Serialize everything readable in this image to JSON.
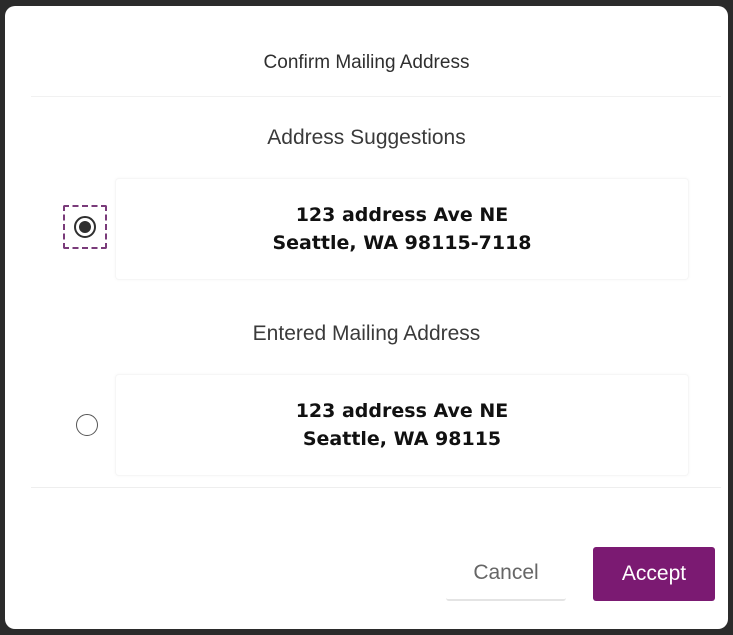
{
  "dialog": {
    "title": "Confirm Mailing Address"
  },
  "suggestions": {
    "heading": "Address Suggestions",
    "address": {
      "line1": "123 address Ave NE",
      "line2": "Seattle, WA 98115-7118"
    },
    "selected": true
  },
  "entered": {
    "heading": "Entered Mailing Address",
    "address": {
      "line1": "123 address Ave NE",
      "line2": "Seattle, WA 98115"
    },
    "selected": false
  },
  "footer": {
    "cancel_label": "Cancel",
    "accept_label": "Accept"
  },
  "colors": {
    "accent": "#7b1a72",
    "focus_outline": "#7a3b7a"
  }
}
